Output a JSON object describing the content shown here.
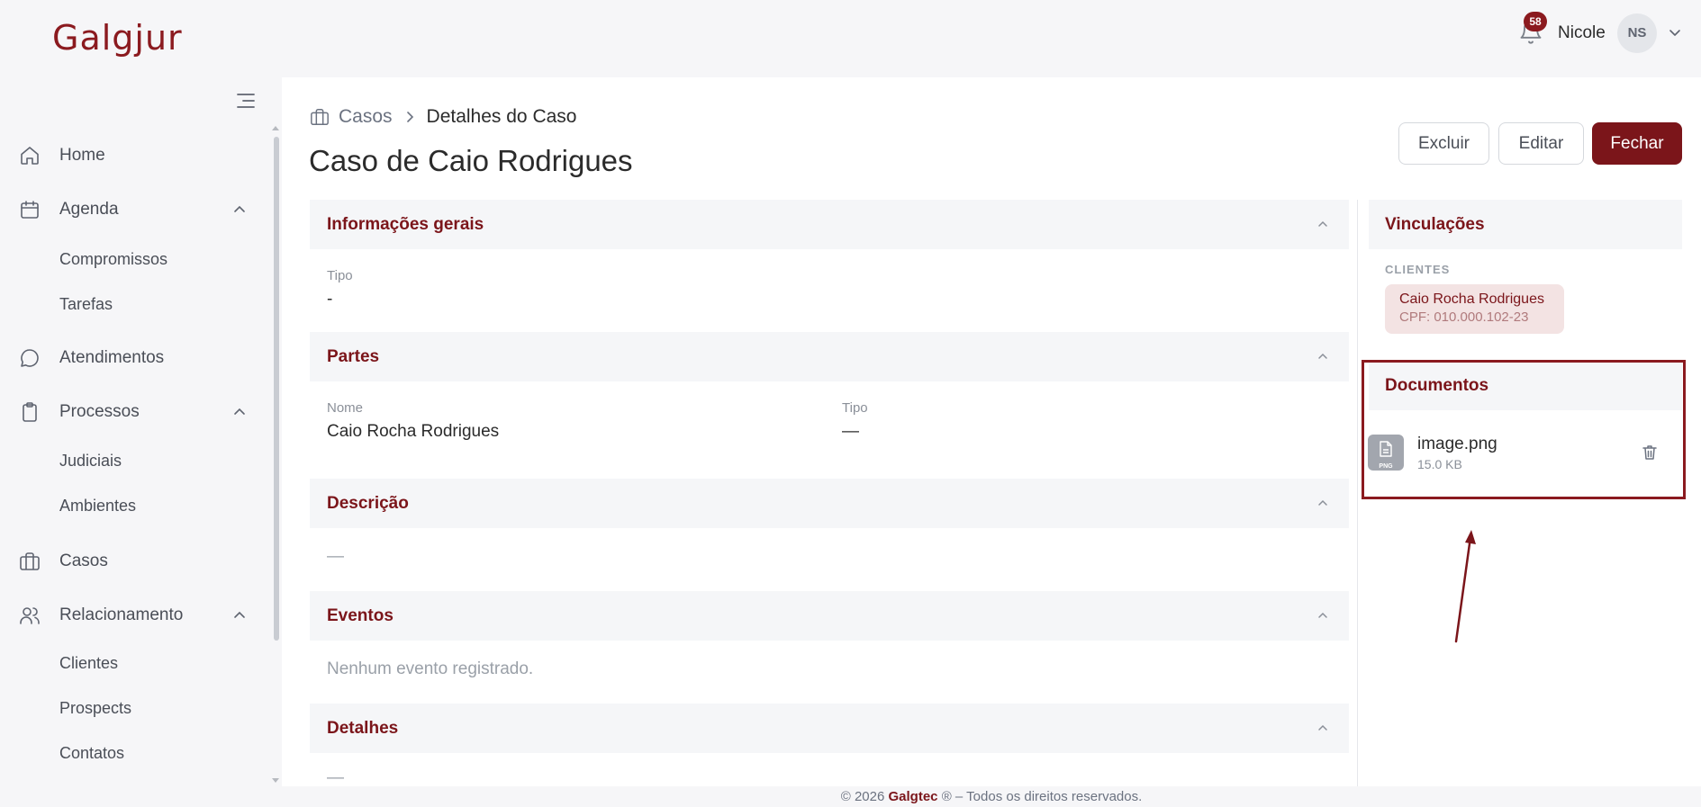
{
  "app": {
    "logo_text": "Galgjur"
  },
  "header": {
    "notification_count": "58",
    "user_name": "Nicole",
    "user_initials": "NS"
  },
  "sidebar": {
    "items": [
      {
        "label": "Home",
        "icon": "home-icon"
      },
      {
        "label": "Agenda",
        "icon": "calendar-icon",
        "expanded": true,
        "children": [
          "Compromissos",
          "Tarefas"
        ]
      },
      {
        "label": "Atendimentos",
        "icon": "chat-icon"
      },
      {
        "label": "Processos",
        "icon": "clipboard-icon",
        "expanded": true,
        "children": [
          "Judiciais",
          "Ambientes"
        ]
      },
      {
        "label": "Casos",
        "icon": "briefcase-icon"
      },
      {
        "label": "Relacionamento",
        "icon": "users-icon",
        "expanded": true,
        "children": [
          "Clientes",
          "Prospects",
          "Contatos"
        ]
      }
    ]
  },
  "breadcrumb": {
    "root": "Casos",
    "current": "Detalhes do Caso"
  },
  "page": {
    "title": "Caso de Caio Rodrigues"
  },
  "actions": {
    "delete": "Excluir",
    "edit": "Editar",
    "close": "Fechar"
  },
  "sections": {
    "general": {
      "title": "Informações gerais",
      "tipo_label": "Tipo",
      "tipo_value": "-"
    },
    "parties": {
      "title": "Partes",
      "name_label": "Nome",
      "name_value": "Caio Rocha Rodrigues",
      "type_label": "Tipo",
      "type_value": "—"
    },
    "description": {
      "title": "Descrição",
      "value": "—"
    },
    "events": {
      "title": "Eventos",
      "empty": "Nenhum evento registrado."
    },
    "details": {
      "title": "Detalhes",
      "value": "—"
    }
  },
  "right_panel": {
    "links_title": "Vinculações",
    "clients_label": "CLIENTES",
    "client": {
      "name": "Caio Rocha Rodrigues",
      "cpf": "CPF: 010.000.102-23"
    },
    "documents_title": "Documentos",
    "document": {
      "name": "image.png",
      "size": "15.0 KB",
      "ext": "PNG"
    }
  },
  "footer": {
    "prefix": "© 2026",
    "brand": "Galgtec",
    "suffix": "® – Todos os direitos reservados."
  },
  "colors": {
    "brand": "#7b151a",
    "highlight": "#8b1a1f"
  }
}
